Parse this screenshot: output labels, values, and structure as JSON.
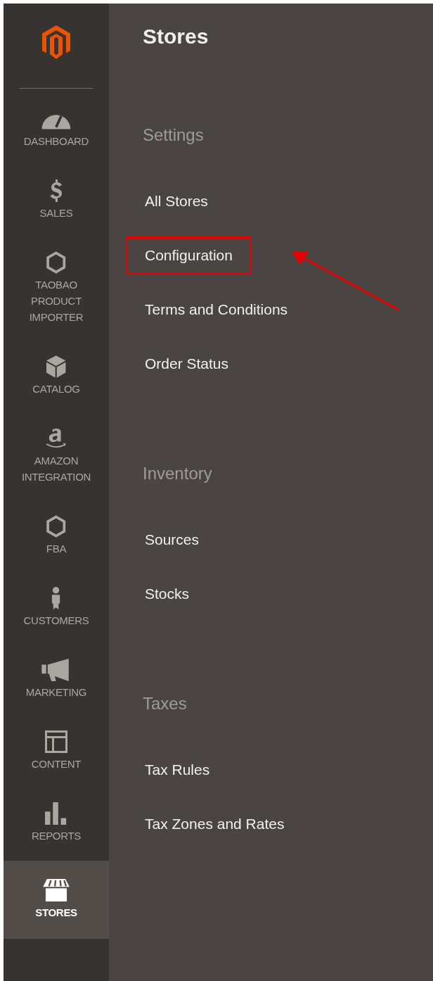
{
  "sidebar": {
    "items": [
      {
        "label": "DASHBOARD",
        "kind": "gauge",
        "selected": false
      },
      {
        "label": "SALES",
        "kind": "dollar",
        "selected": false
      },
      {
        "label": "TAOBAO PRODUCT IMPORTER",
        "kind": "hexagon",
        "selected": false
      },
      {
        "label": "CATALOG",
        "kind": "box",
        "selected": false
      },
      {
        "label": "AMAZON INTEGRATION",
        "kind": "amazon",
        "selected": false
      },
      {
        "label": "FBA",
        "kind": "hexagon",
        "selected": false
      },
      {
        "label": "CUSTOMERS",
        "kind": "person",
        "selected": false
      },
      {
        "label": "MARKETING",
        "kind": "megaphone",
        "selected": false
      },
      {
        "label": "CONTENT",
        "kind": "layout",
        "selected": false
      },
      {
        "label": "REPORTS",
        "kind": "bars",
        "selected": false
      },
      {
        "label": "STORES",
        "kind": "store",
        "selected": true
      }
    ]
  },
  "menu": {
    "title": "Stores",
    "sections": [
      {
        "heading": "Settings",
        "items": [
          {
            "label": "All Stores",
            "highlighted": false
          },
          {
            "label": "Configuration",
            "highlighted": true
          },
          {
            "label": "Terms and Conditions",
            "highlighted": false
          },
          {
            "label": "Order Status",
            "highlighted": false
          }
        ]
      },
      {
        "heading": "Inventory",
        "items": [
          {
            "label": "Sources",
            "highlighted": false
          },
          {
            "label": "Stocks",
            "highlighted": false
          }
        ]
      },
      {
        "heading": "Taxes",
        "items": [
          {
            "label": "Tax Rules",
            "highlighted": false
          },
          {
            "label": "Tax Zones and Rates",
            "highlighted": false
          }
        ]
      }
    ]
  }
}
